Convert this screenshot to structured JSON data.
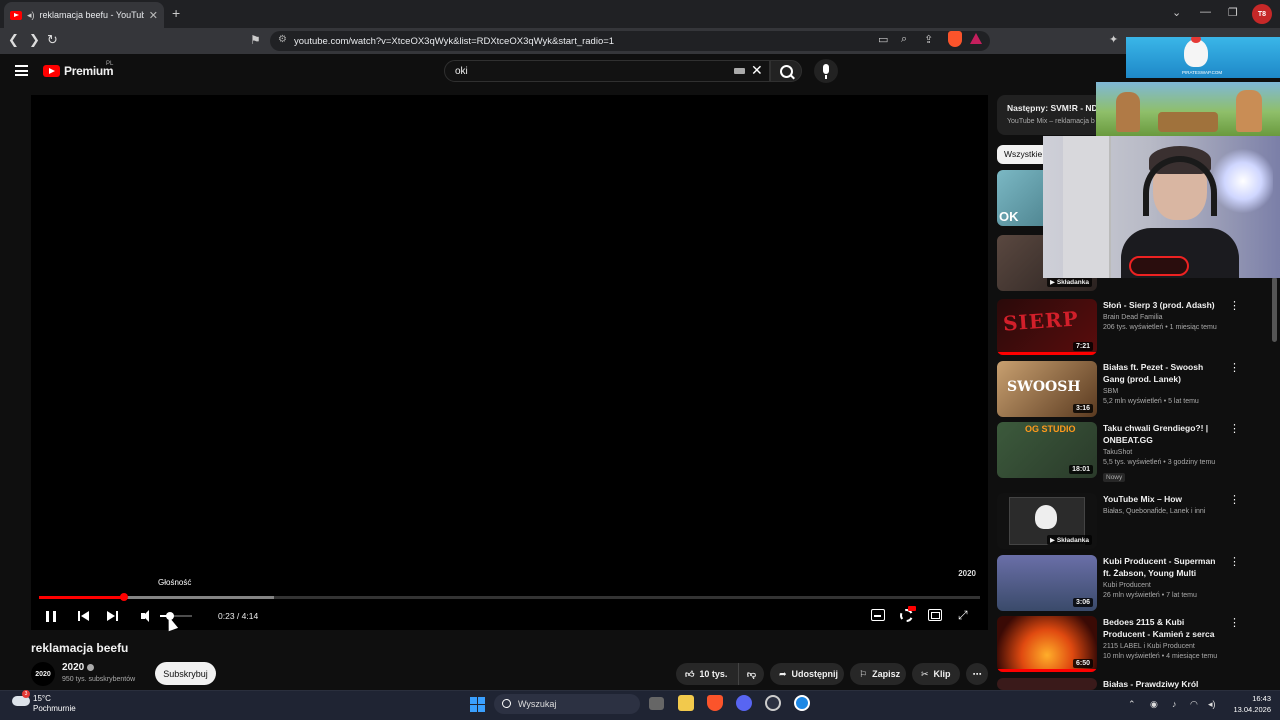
{
  "browser": {
    "tab_title": "reklamacja beefu - YouTube",
    "url": "youtube.com/watch?v=XtceOX3qWyk&list=RDXtceOX3qWyk&start_radio=1",
    "new_tab_label": "+",
    "profile_label": "T8"
  },
  "header": {
    "logo_text": "Premium",
    "logo_region": "PL",
    "search_value": "oki"
  },
  "player": {
    "watermark": "2020",
    "tooltip": "Głośność",
    "time": "0:23 / 4:14",
    "progress_fraction": 0.09,
    "buffered_fraction": 0.25,
    "volume_fraction": 0.3
  },
  "video": {
    "title": "reklamacja beefu",
    "channel_avatar": "2020",
    "channel_name": "2020",
    "subscribers": "950 tys. subskrybentów",
    "subscribe_label": "Subskrybuj",
    "likes": "10 tys.",
    "share_label": "Udostępnij",
    "save_label": "Zapisz",
    "clip_label": "Klip"
  },
  "sidebar": {
    "up_next_title": "Następny: SVM!R - NDA",
    "up_next_sub": "YouTube Mix – reklamacja b",
    "chip_label": "Wszystkie",
    "mix_badge": "Składanka",
    "new_badge": "Nowy",
    "recommendations": [
      {
        "title": "",
        "channel": "",
        "meta": "",
        "duration": "",
        "thumb_text": "OK"
      },
      {
        "title": "",
        "channel": "",
        "meta": "",
        "duration": "",
        "mix": true
      },
      {
        "title": "Słoń - Sierp 3 (prod. Adash)",
        "channel": "Brain Dead Familia",
        "meta": "206 tys. wyświetleń • 1 miesiąc temu",
        "duration": "7:21",
        "thumb_text": "SIERP"
      },
      {
        "title": "Białas ft. Pezet - Swoosh Gang (prod. Lanek)",
        "channel": "SBM",
        "meta": "5,2 mln wyświetleń • 5 lat temu",
        "duration": "3:16",
        "thumb_text": "SWOOSH"
      },
      {
        "title": "Taku chwali Grendiego?! | ONBEAT.GG",
        "channel": "TakuShot",
        "meta": "5,5 tys. wyświetleń • 3 godziny temu",
        "duration": "18:01",
        "thumb_text": "OG STUDIO",
        "new": true
      },
      {
        "title": "YouTube Mix – How",
        "channel": "Białas, Quebonafide, Lanek i inni",
        "meta": "",
        "duration": "",
        "mix": true
      },
      {
        "title": "Kubi Producent - Superman ft. Żabson, Young Multi",
        "channel": "Kubi Producent",
        "meta": "26 mln wyświetleń • 7 lat temu",
        "duration": "3:06"
      },
      {
        "title": "Bedoes 2115 & Kubi Producent - Kamień z serca",
        "channel": "2115 LABEL i Kubi Producent",
        "meta": "10 mln wyświetleń • 4 miesiące temu",
        "duration": "6:50"
      },
      {
        "title": "Białas - Prawdziwy Król",
        "channel": "",
        "meta": "",
        "duration": ""
      }
    ]
  },
  "overlays": {
    "ad_caption": "PIRATESWAP.COM"
  },
  "taskbar": {
    "temperature": "15°C",
    "weather": "Pochmurnie",
    "weather_badge": "3",
    "search_label": "Wyszukaj",
    "time": "16:43",
    "date": "13.04.2026"
  }
}
